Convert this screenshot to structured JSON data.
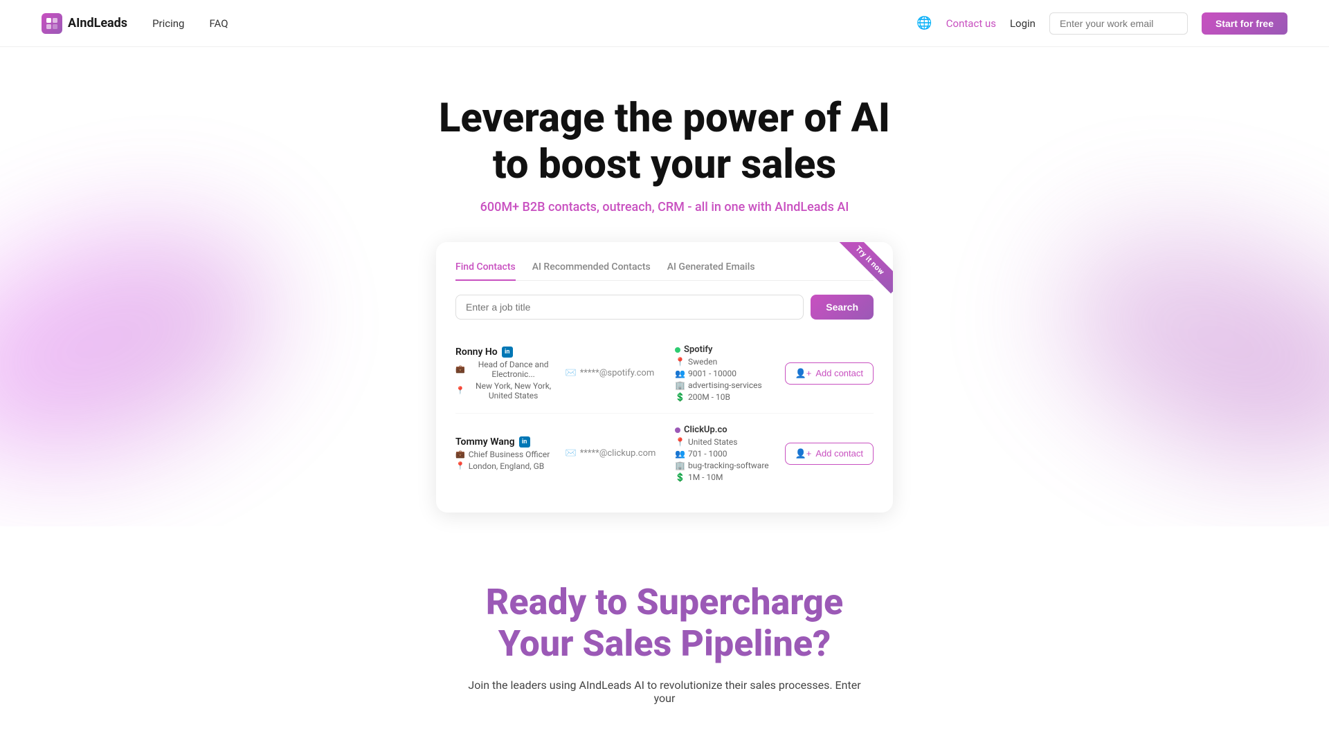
{
  "nav": {
    "logo_text": "AIndLeads",
    "logo_letter": "A",
    "pricing_label": "Pricing",
    "faq_label": "FAQ",
    "contact_label": "Contact us",
    "login_label": "Login",
    "email_placeholder": "Enter your work email",
    "start_btn_label": "Start for free"
  },
  "hero": {
    "title_line1": "Leverage the power of AI",
    "title_line2": "to boost your sales",
    "subtitle": "600M+ B2B contacts, outreach, CRM - all in one with AIndLeads AI"
  },
  "demo": {
    "try_it_label": "Try it now",
    "tabs": [
      {
        "label": "Find Contacts",
        "active": true
      },
      {
        "label": "AI Recommended Contacts",
        "active": false
      },
      {
        "label": "AI Generated Emails",
        "active": false
      }
    ],
    "search_placeholder": "Enter a job title",
    "search_btn": "Search",
    "contacts": [
      {
        "name": "Ronny Ho",
        "title": "Head of Dance and Electronic...",
        "location": "New York, New York, United States",
        "email": "*****@spotify.com",
        "company_name": "Spotify",
        "company_dot": "green",
        "company_country": "Sweden",
        "company_employees": "9001 - 10000",
        "company_industry": "advertising-services",
        "company_revenue": "200M - 10B",
        "add_btn": "Add contact"
      },
      {
        "name": "Tommy Wang",
        "title": "Chief Business Officer",
        "location": "London, England, GB",
        "email": "*****@clickup.com",
        "company_name": "ClickUp.co",
        "company_dot": "purple",
        "company_country": "United States",
        "company_employees": "701 - 1000",
        "company_industry": "bug-tracking-software",
        "company_revenue": "1M - 10M",
        "add_btn": "Add contact"
      }
    ]
  },
  "bottom": {
    "title_line1": "Ready to Supercharge",
    "title_line2": "Your Sales Pipeline?",
    "subtitle": "Join the leaders using AIndLeads AI to revolutionize their sales processes. Enter your"
  }
}
